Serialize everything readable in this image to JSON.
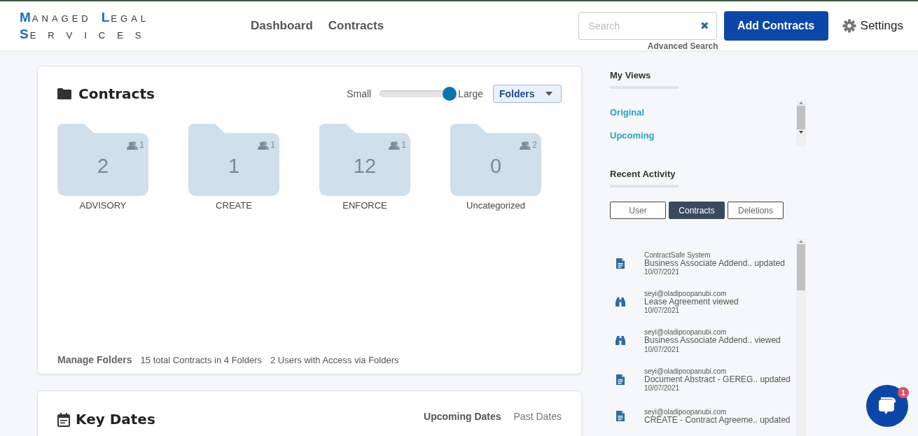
{
  "logo": {
    "lines": [
      [
        {
          "initial": "M",
          "rest": "ANAGED"
        },
        {
          "initial": "L",
          "rest": "EGAL"
        }
      ],
      [
        {
          "initial": "S",
          "rest": "ERVICES"
        }
      ]
    ]
  },
  "nav": [
    {
      "label": "Dashboard"
    },
    {
      "label": "Contracts"
    }
  ],
  "search": {
    "placeholder": "Search",
    "clear": "✖",
    "advanced": "Advanced Search"
  },
  "add_button": "Add Contracts",
  "settings": "Settings",
  "contracts_card": {
    "title": "Contracts",
    "size_small": "Small",
    "size_large": "Large",
    "level": 1,
    "view_select": "Folders",
    "folders": [
      {
        "count": "2",
        "users": "1",
        "name": "ADVISORY"
      },
      {
        "count": "1",
        "users": "1",
        "name": "CREATE"
      },
      {
        "count": "12",
        "users": "1",
        "name": "ENFORCE"
      },
      {
        "count": "0",
        "users": "2",
        "name": "Uncategorized"
      }
    ],
    "manage": "Manage Folders",
    "total": "15 total Contracts in 4 Folders",
    "access": "2 Users with Access via Folders"
  },
  "key_dates": {
    "title": "Key Dates",
    "tabs": [
      {
        "label": "Upcoming Dates",
        "selected": true
      },
      {
        "label": "Past Dates",
        "selected": false
      }
    ]
  },
  "my_views": {
    "title": "My Views",
    "items": [
      "Original",
      "Upcoming"
    ]
  },
  "recent_activity": {
    "title": "Recent Activity",
    "tabs": [
      {
        "label": "User",
        "selected": false
      },
      {
        "label": "Contracts",
        "selected": true
      },
      {
        "label": "Deletions",
        "selected": false
      }
    ],
    "items": [
      {
        "kind": "document",
        "user": "ContractSafe System",
        "text": "Business Associate Addend.. updated",
        "date": "10/07/2021"
      },
      {
        "kind": "binoculars",
        "user": "seyi@oladipoopanubi.com",
        "text": "Lease Agreement viewed",
        "date": "10/07/2021"
      },
      {
        "kind": "binoculars",
        "user": "seyi@oladipoopanubi.com",
        "text": "Business Associate Addend.. viewed",
        "date": "10/07/2021"
      },
      {
        "kind": "document",
        "user": "seyi@oladipoopanubi.com",
        "text": "Document Abstract - GEREG.. updated",
        "date": "10/07/2021"
      },
      {
        "kind": "document",
        "user": "seyi@oladipoopanubi.com",
        "text": "CREATE - Contract Agreeme.. updated"
      }
    ]
  },
  "chat": {
    "badge": "1"
  }
}
